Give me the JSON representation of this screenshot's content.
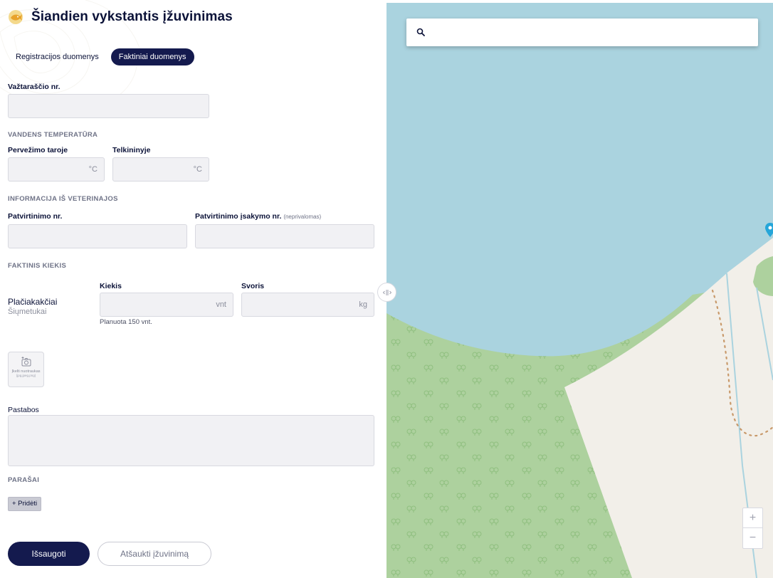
{
  "header": {
    "title": "Šiandien vykstantis įžuvinimas",
    "icon": "fish-icon"
  },
  "tabs": [
    {
      "label": "Registracijos duomenys",
      "active": false
    },
    {
      "label": "Faktiniai duomenys",
      "active": true
    }
  ],
  "waybill": {
    "label": "Važtaraščio nr.",
    "value": ""
  },
  "water_temperature": {
    "section": "VANDENS TEMPERATŪRA",
    "transport_label": "Pervežimo taroje",
    "reservoir_label": "Telkininyje",
    "unit": "°C",
    "transport_value": "",
    "reservoir_value": ""
  },
  "veterinary": {
    "section": "INFORMACIJA IŠ VETERINAJOS",
    "approval_no_label": "Patvirtinimo nr.",
    "approval_order_label": "Patvirtinimo įsakymo nr.",
    "optional_note": "(neprivalomas)",
    "approval_no_value": "",
    "approval_order_value": ""
  },
  "actual_quantity": {
    "section": "FAKTINIS KIEKIS",
    "quantity_label": "Kiekis",
    "weight_label": "Svoris",
    "fish_name": "Plačiakakčiai",
    "fish_age": "Šiųmetukai",
    "quantity_unit": "vnt",
    "weight_unit": "kg",
    "planned_text": "Planuota 150 vnt.",
    "quantity_value": "",
    "weight_value": ""
  },
  "upload": {
    "line1": "Įkelti nuotraukas",
    "line2": "(jpg,jpeg,png)",
    "icon": "camera-icon"
  },
  "notes": {
    "label": "Pastabos",
    "value": ""
  },
  "signatures": {
    "section": "PARAŠAI",
    "add_label": "+ Pridėti"
  },
  "actions": {
    "save_label": "Išsaugoti",
    "cancel_label": "Atšaukti įžuvinimą"
  },
  "map": {
    "search_placeholder": "",
    "search_icon": "search-icon",
    "zoom_in": "+",
    "zoom_out": "−",
    "colors": {
      "water": "#aad3df",
      "forest": "#add19e",
      "land": "#f2efe9",
      "path": "#c8996a"
    }
  },
  "colors": {
    "primary": "#141a4e",
    "field_bg": "#f1f1f4"
  }
}
